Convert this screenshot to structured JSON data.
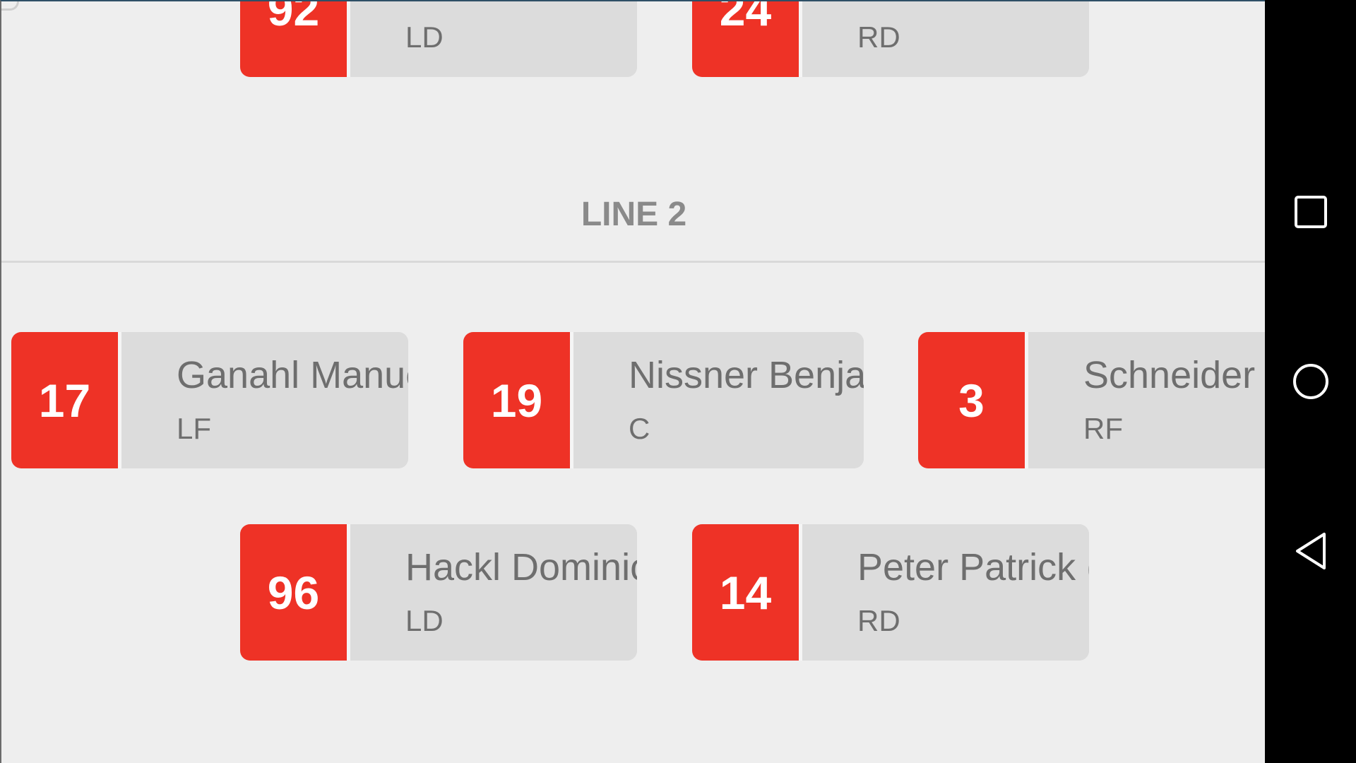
{
  "line1_partial": [
    {
      "number": "92",
      "position": "LD"
    },
    {
      "number": "24",
      "position": "RD"
    }
  ],
  "line2": {
    "title": "LINE 2",
    "forwards": [
      {
        "number": "17",
        "name": "Ganahl Manue",
        "position": "LF"
      },
      {
        "number": "19",
        "name": "Nissner Benja",
        "position": "C"
      },
      {
        "number": "3",
        "name": "Schneider",
        "position": "RF"
      }
    ],
    "defense": [
      {
        "number": "96",
        "name": "Hackl Dominic",
        "position": "LD"
      },
      {
        "number": "14",
        "name": "Peter Patrick (",
        "position": "RD"
      }
    ]
  },
  "navbar": {
    "buttons": [
      "recent-apps",
      "home",
      "back"
    ]
  },
  "colors": {
    "number_bg": "#ee3226",
    "card_bg": "#dcdcdc",
    "screen_bg": "#eeeeee",
    "text": "#6e6e6e"
  }
}
